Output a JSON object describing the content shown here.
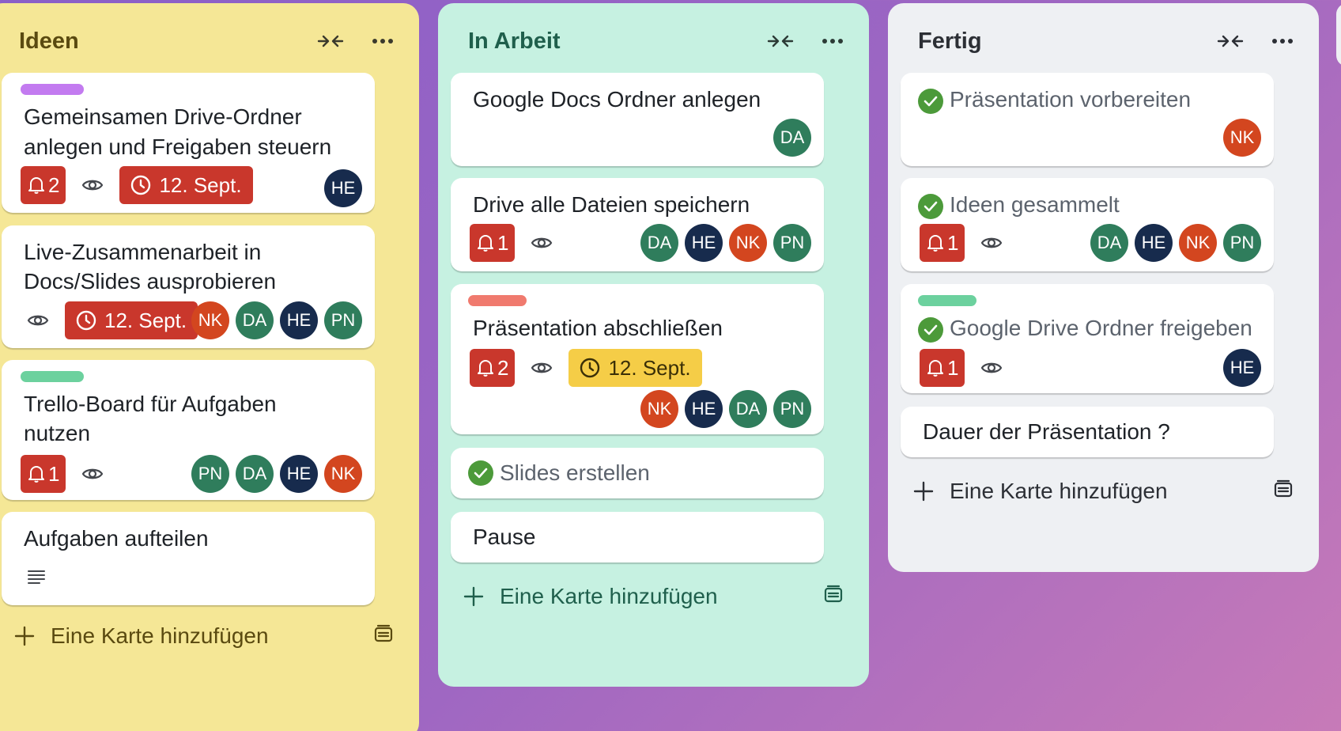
{
  "lists": [
    {
      "title": "Ideen",
      "add_label": "Eine Karte hinzufügen",
      "cards": [
        {
          "title_line1": "Gemeinsamen Drive-Ordner",
          "title_line2": "anlegen und Freigaben steuern",
          "label_color": "#c37bf0",
          "notifications": "2",
          "due": "12. Sept.",
          "members": [
            "HE"
          ]
        },
        {
          "title_line1": "Live-Zusammenarbeit in",
          "title_line2": "Docs/Slides ausprobieren",
          "due": "12. Sept.",
          "members": [
            "NK",
            "DA",
            "HE",
            "PN"
          ]
        },
        {
          "title_line1": "Trello-Board für Aufgaben",
          "title_line2": "nutzen",
          "label_color": "#6cd19e",
          "notifications": "1",
          "members": [
            "PN",
            "DA",
            "HE",
            "NK"
          ]
        },
        {
          "title": "Aufgaben aufteilen",
          "has_description": true
        }
      ]
    },
    {
      "title": "In Arbeit",
      "add_label": "Eine Karte hinzufügen",
      "cards": [
        {
          "title": "Google Docs Ordner anlegen",
          "members": [
            "DA"
          ]
        },
        {
          "title": "Drive alle Dateien speichern",
          "notifications": "1",
          "members": [
            "DA",
            "HE",
            "NK",
            "PN"
          ]
        },
        {
          "title": "Präsentation abschließen",
          "label_color": "#f07a6e",
          "notifications": "2",
          "due": "12. Sept.",
          "members": [
            "NK",
            "HE",
            "DA",
            "PN"
          ]
        },
        {
          "title": "Slides erstellen",
          "done": true
        },
        {
          "title": "Pause"
        }
      ]
    },
    {
      "title": "Fertig",
      "add_label": "Eine Karte hinzufügen",
      "cards": [
        {
          "title": "Präsentation vorbereiten",
          "done": true,
          "members": [
            "NK"
          ]
        },
        {
          "title": "Ideen gesammelt",
          "done": true,
          "notifications": "1",
          "members": [
            "DA",
            "HE",
            "NK",
            "PN"
          ]
        },
        {
          "title": "Google Drive Ordner freigeben",
          "done": true,
          "label_color": "#6cd19e",
          "notifications": "1",
          "members": [
            "HE"
          ]
        },
        {
          "title": "Dauer der Präsentation ?"
        }
      ]
    }
  ],
  "colors": {
    "overdue": "#c9372c",
    "due_soon": "#f5cd47",
    "done": "#4c9a3a"
  },
  "icons": [
    "collapse-icon",
    "more-icon",
    "bell-icon",
    "eye-icon",
    "clock-icon",
    "check-icon",
    "description-icon",
    "plus-icon",
    "template-icon"
  ]
}
